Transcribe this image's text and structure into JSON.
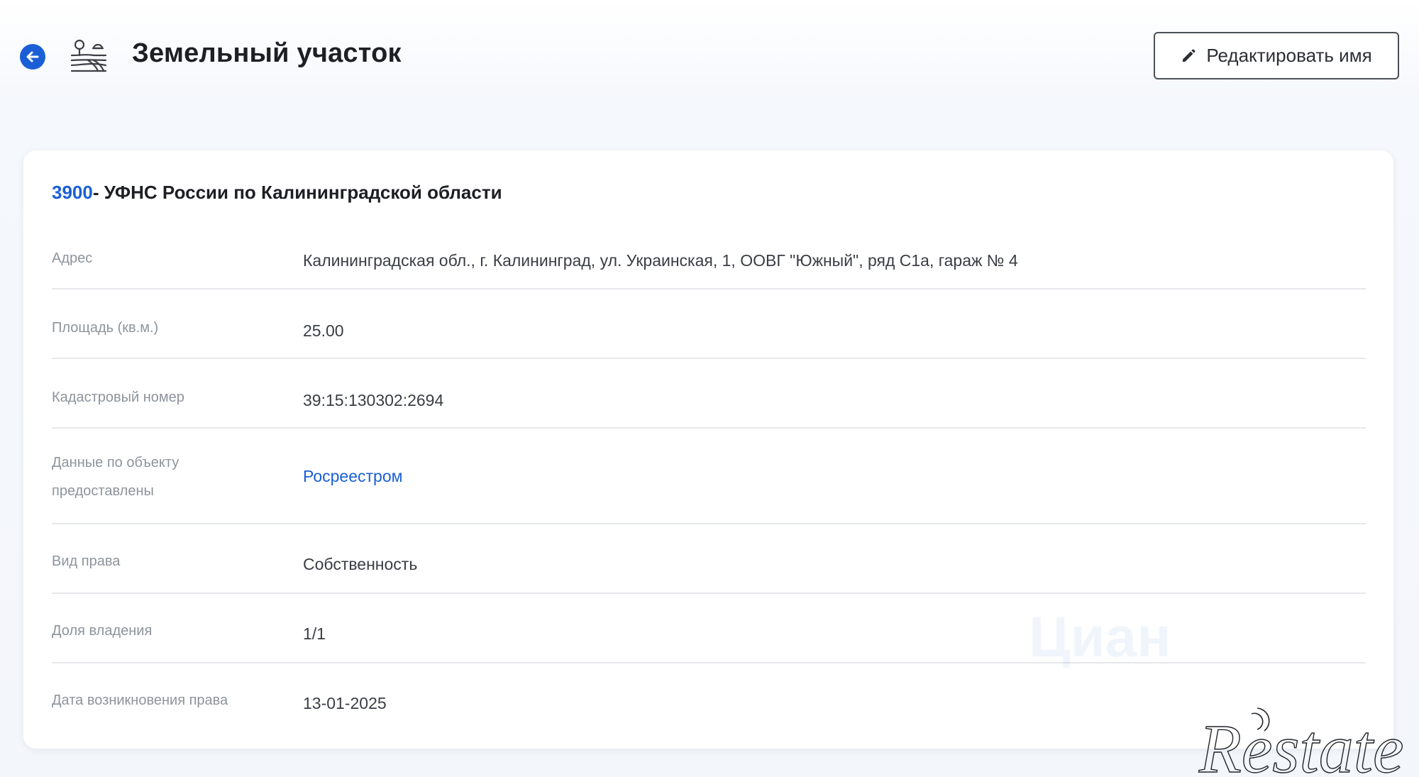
{
  "header": {
    "title": "Земельный участок",
    "edit_button_label": "Редактировать имя"
  },
  "card": {
    "code": "3900",
    "authority": "- УФНС России по Калининградской области",
    "rows": [
      {
        "label": "Адрес",
        "value": "Калининградская обл., г. Калининград, ул. Украинская, 1, ООВГ \"Южный\", ряд С1а, гараж № 4"
      },
      {
        "label": "Площадь (кв.м.)",
        "value": "25.00"
      },
      {
        "label": "Кадастровый номер",
        "value": "39:15:130302:2694"
      },
      {
        "label_line1": "Данные по объекту",
        "label_line2": "предоставлены",
        "value": "Росреестром"
      },
      {
        "label": "Вид права",
        "value": "Собственность"
      },
      {
        "label": "Доля владения",
        "value": "1/1"
      },
      {
        "label": "Дата возникновения права",
        "value": "13-01-2025"
      }
    ]
  },
  "watermark": {
    "brand": "Restate",
    "faint_brand": "Циан"
  },
  "colors": {
    "accent": "#1a5fd6",
    "title": "#1d1f24",
    "label": "#8d949c",
    "value": "#3a3e44",
    "divider": "#e6e8eb"
  },
  "icons": {
    "back": "arrow-left-circle-icon",
    "land": "land-plot-icon",
    "edit": "pencil-icon"
  }
}
